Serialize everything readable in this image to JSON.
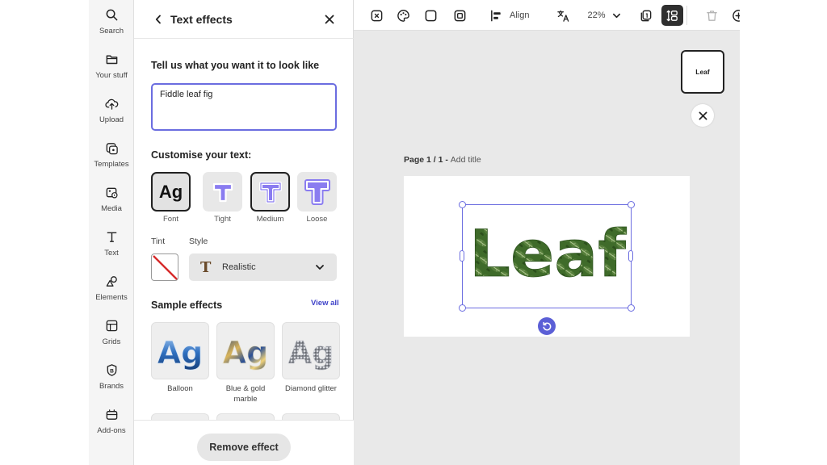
{
  "rail": {
    "items": [
      {
        "label": "Search",
        "icon": "search-icon"
      },
      {
        "label": "Your stuff",
        "icon": "folder-icon"
      },
      {
        "label": "Upload",
        "icon": "upload-cloud-icon"
      },
      {
        "label": "Templates",
        "icon": "templates-icon"
      },
      {
        "label": "Media",
        "icon": "media-icon"
      },
      {
        "label": "Text",
        "icon": "text-icon"
      },
      {
        "label": "Elements",
        "icon": "elements-icon"
      },
      {
        "label": "Grids",
        "icon": "grids-icon"
      },
      {
        "label": "Brands",
        "icon": "brands-icon"
      },
      {
        "label": "Add-ons",
        "icon": "add-ons-icon"
      }
    ]
  },
  "panel": {
    "title": "Text effects",
    "prompt_label": "Tell us what you want it to look like",
    "prompt_value": "Fiddle leaf fig",
    "customise_label": "Customise your text:",
    "shape_options": [
      {
        "label": "Font",
        "selected": true
      },
      {
        "label": "Tight",
        "selected": false
      },
      {
        "label": "Medium",
        "selected": true
      },
      {
        "label": "Loose",
        "selected": false
      }
    ],
    "font_preview": "Ag",
    "tint_label": "Tint",
    "style_label": "Style",
    "style_value": "Realistic",
    "sample_effects_label": "Sample effects",
    "view_all_label": "View all",
    "samples": [
      {
        "label": "Balloon",
        "text": "Ag"
      },
      {
        "label": "Blue & gold marble",
        "text": "Ag"
      },
      {
        "label": "Diamond glitter",
        "text": "Ag"
      }
    ],
    "remove_button_label": "Remove effect"
  },
  "toolbar": {
    "align_label": "Align",
    "zoom_value": "22%"
  },
  "canvas": {
    "page_prefix": "Page 1 / 1 - ",
    "page_title_placeholder": "Add title",
    "text_content": "Leaf",
    "thumb_label": "Leaf"
  },
  "colors": {
    "accent": "#6b6de0",
    "leaf_green": "#3f6b2a",
    "link_blue": "#3f43c9"
  }
}
